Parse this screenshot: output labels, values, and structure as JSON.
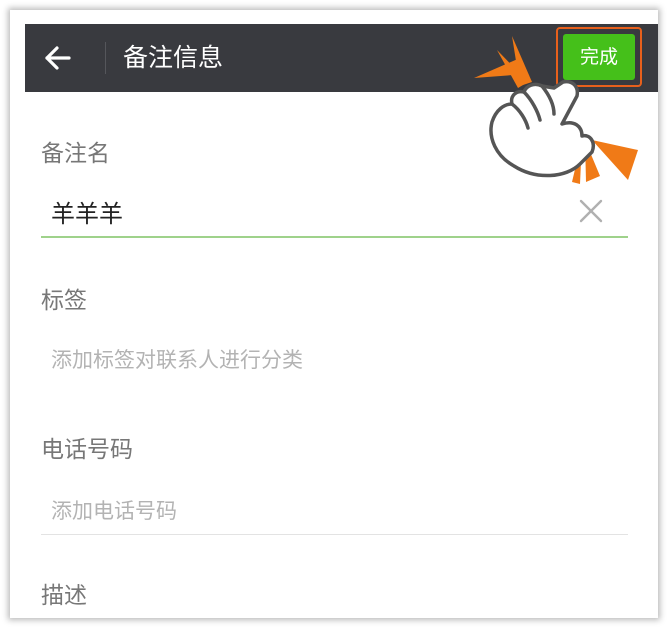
{
  "header": {
    "back_icon": "arrow-left-icon",
    "title": "备注信息",
    "done_label": "完成",
    "done_color": "#45c01a",
    "bar_color": "#393a3f"
  },
  "remark_name": {
    "label": "备注名",
    "value": "羊羊羊",
    "clear_icon": "close-icon"
  },
  "tags": {
    "label": "标签",
    "placeholder": "添加标签对联系人进行分类"
  },
  "phone": {
    "label": "电话号码",
    "placeholder": "添加电话号码"
  },
  "description": {
    "label": "描述"
  },
  "annotation": {
    "icon": "pointing-hand-icon",
    "accent_color": "#f07a17"
  }
}
